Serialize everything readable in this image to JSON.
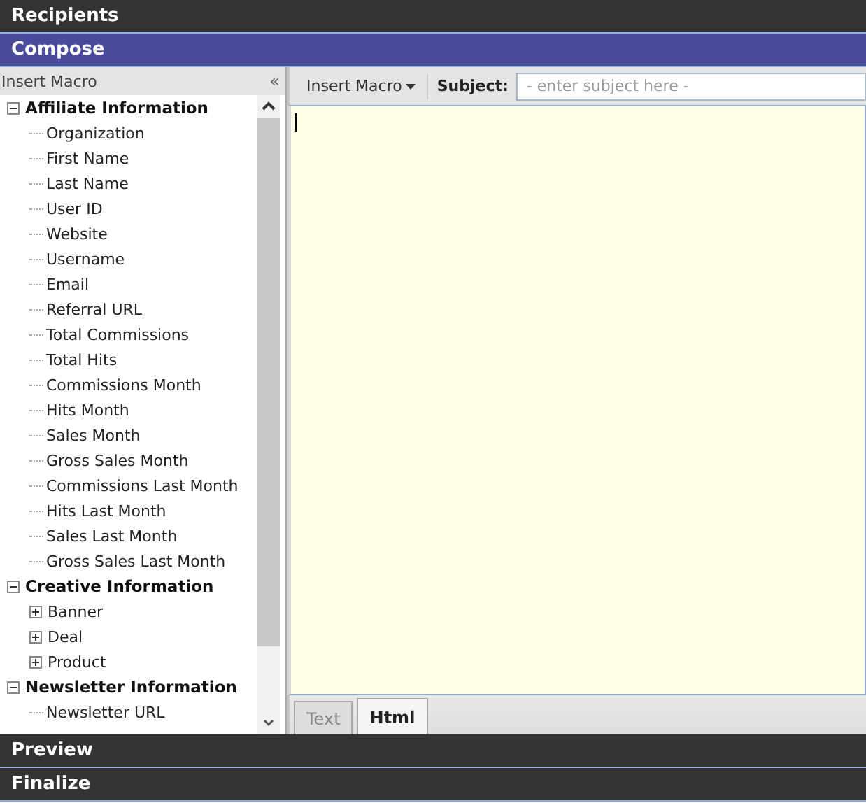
{
  "sections_top": [
    {
      "title": "Recipients",
      "kind": "dark"
    },
    {
      "title": "Compose",
      "kind": "active"
    }
  ],
  "macro_panel": {
    "title": "Insert Macro",
    "collapse_glyph": "«",
    "tree": [
      {
        "label": "Affiliate Information",
        "expanded": true,
        "children": [
          {
            "label": "Organization"
          },
          {
            "label": "First Name"
          },
          {
            "label": "Last Name"
          },
          {
            "label": "User ID"
          },
          {
            "label": "Website"
          },
          {
            "label": "Username"
          },
          {
            "label": "Email"
          },
          {
            "label": "Referral URL"
          },
          {
            "label": "Total Commissions"
          },
          {
            "label": "Total Hits"
          },
          {
            "label": "Commissions Month"
          },
          {
            "label": "Hits Month"
          },
          {
            "label": "Sales Month"
          },
          {
            "label": "Gross Sales Month"
          },
          {
            "label": "Commissions Last Month"
          },
          {
            "label": "Hits Last Month"
          },
          {
            "label": "Sales Last Month"
          },
          {
            "label": "Gross Sales Last Month"
          }
        ]
      },
      {
        "label": "Creative Information",
        "expanded": true,
        "children": [
          {
            "label": "Banner",
            "expanded": false
          },
          {
            "label": "Deal",
            "expanded": false
          },
          {
            "label": "Product",
            "expanded": false
          }
        ]
      },
      {
        "label": "Newsletter Information",
        "expanded": true,
        "children": [
          {
            "label": "Newsletter URL"
          }
        ]
      }
    ]
  },
  "toolbar": {
    "insert_macro": "Insert Macro",
    "subject_label": "Subject:",
    "subject_placeholder": "- enter subject here -"
  },
  "editor_tabs": [
    {
      "label": "Text",
      "selected": false
    },
    {
      "label": "Html",
      "selected": true
    }
  ],
  "sections_bottom": [
    {
      "title": "Preview",
      "kind": "dark"
    },
    {
      "title": "Finalize",
      "kind": "dark"
    }
  ]
}
